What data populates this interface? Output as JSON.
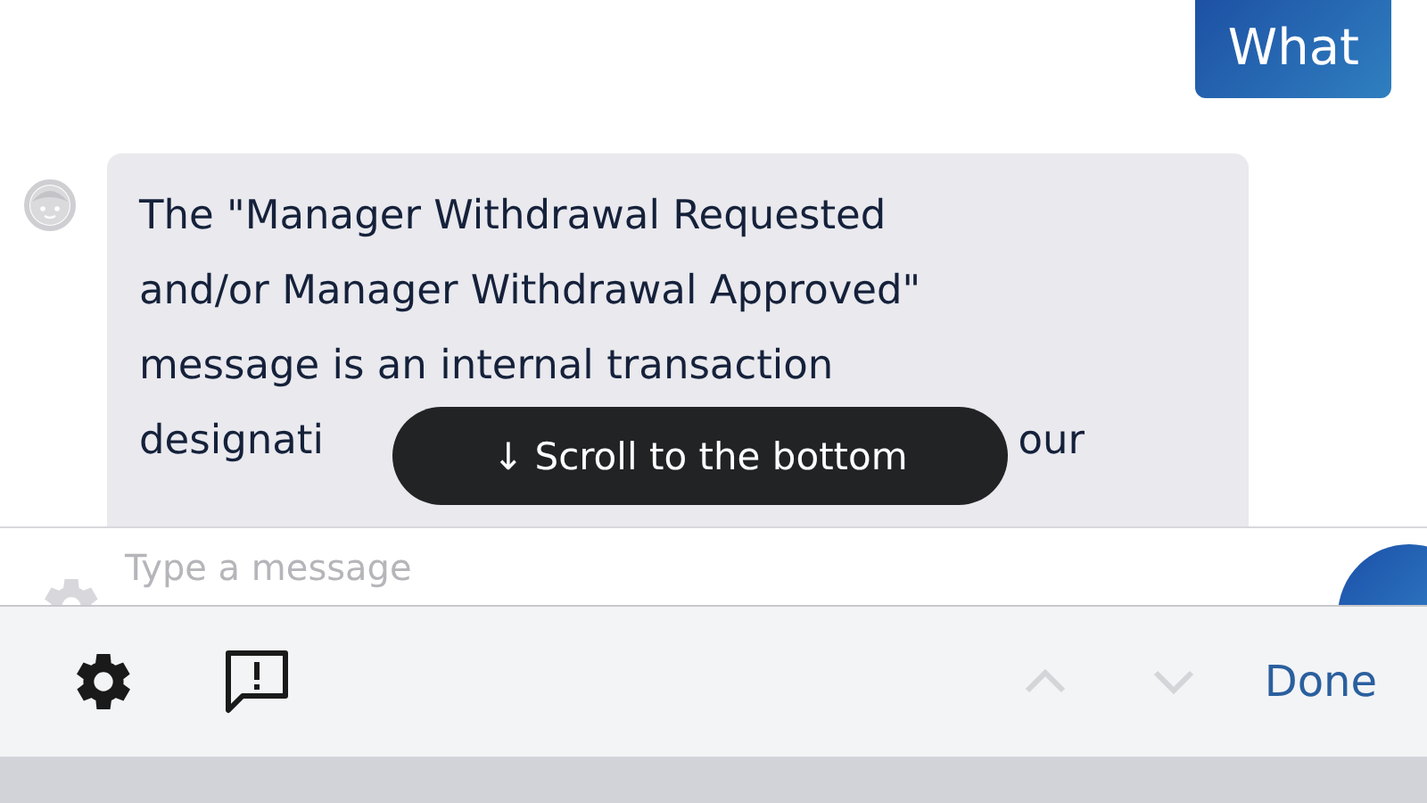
{
  "user_message": {
    "text": "What"
  },
  "bot_message": {
    "lines": [
      "The \"Manager Withdrawal Requested",
      "and/or Manager Withdrawal Approved\"",
      "message is an internal transaction"
    ],
    "partial_line": {
      "start": "designati",
      "end": "our"
    }
  },
  "scroll_toast": {
    "arrow": "↓",
    "label": "Scroll to the bottom"
  },
  "composer": {
    "placeholder": "Type a message"
  },
  "keyboard_toolbar": {
    "prev_disabled": true,
    "next_disabled": true,
    "done": "Done"
  }
}
